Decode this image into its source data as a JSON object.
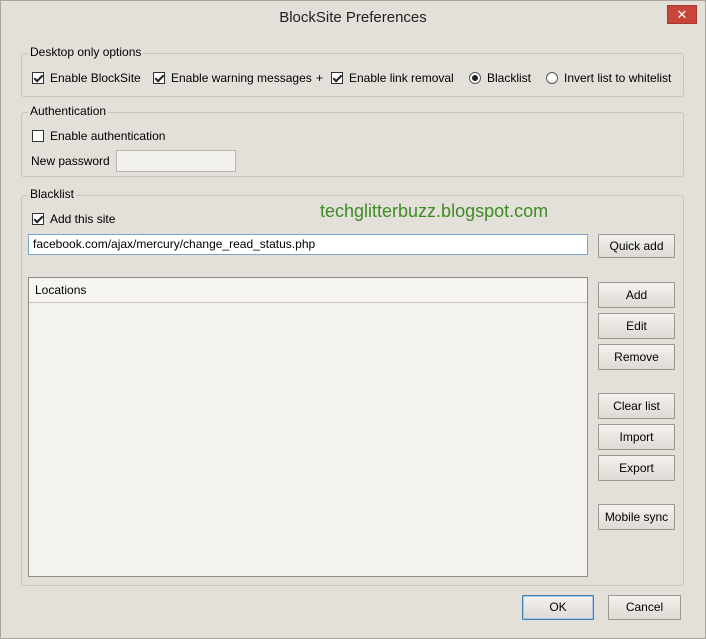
{
  "window": {
    "title": "BlockSite Preferences",
    "close_glyph": "✕"
  },
  "desktop_options": {
    "label": "Desktop only options",
    "enable_blocksite": {
      "label": "Enable BlockSite",
      "checked": true
    },
    "enable_warning": {
      "label": "Enable warning messages",
      "checked": true
    },
    "plus": "+",
    "enable_link_removal": {
      "label": "Enable link removal",
      "checked": true
    },
    "blacklist_radio": {
      "label": "Blacklist",
      "selected": true
    },
    "whitelist_radio": {
      "label": "Invert list to whitelist",
      "selected": false
    }
  },
  "authentication": {
    "label": "Authentication",
    "enable_auth": {
      "label": "Enable authentication",
      "checked": false
    },
    "password_label": "New password",
    "password_value": ""
  },
  "blacklist": {
    "label": "Blacklist",
    "add_site": {
      "label": "Add this site",
      "checked": true
    },
    "url_value": "facebook.com/ajax/mercury/change_read_status.php",
    "quick_add": "Quick add",
    "list_header": "Locations",
    "items": [],
    "buttons": {
      "add": "Add",
      "edit": "Edit",
      "remove": "Remove",
      "clear": "Clear list",
      "import": "Import",
      "export": "Export",
      "mobile_sync": "Mobile sync"
    }
  },
  "watermark": "techglitterbuzz.blogspot.com",
  "footer": {
    "ok": "OK",
    "cancel": "Cancel"
  }
}
